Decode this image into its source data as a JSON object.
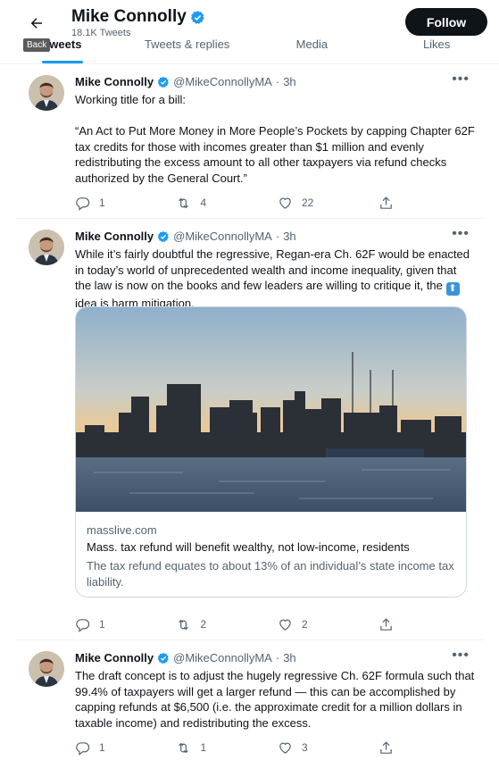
{
  "header": {
    "back_tooltip": "Back",
    "name": "Mike Connolly",
    "tweet_count": "18.1K Tweets",
    "follow_label": "Follow"
  },
  "tabs": [
    {
      "label": "Tweets",
      "active": true
    },
    {
      "label": "Tweets & replies",
      "active": false
    },
    {
      "label": "Media",
      "active": false
    },
    {
      "label": "Likes",
      "active": false
    }
  ],
  "tweets": [
    {
      "name": "Mike Connolly",
      "handle": "@MikeConnollyMA",
      "sep": "·",
      "time": "3h",
      "text": "Working title for a bill:\n\n“An Act to Put More Money in More People’s Pockets by capping Chapter 62F tax credits for those with incomes greater than $1 million and evenly redistributing the excess amount to all other taxpayers via refund checks authorized by the General Court.”",
      "replies": "1",
      "retweets": "4",
      "likes": "22"
    },
    {
      "name": "Mike Connolly",
      "handle": "@MikeConnollyMA",
      "sep": "·",
      "time": "3h",
      "text_before": "While it’s fairly doubtful the regressive, Regan-era Ch. 62F would be enacted in today’s world of unprecedented wealth and income inequality, given that the law is now on the books and few leaders are willing to critique it, the ",
      "emoji": "⬆",
      "text_after": " idea is harm mitigation.",
      "card": {
        "domain": "masslive.com",
        "title": "Mass. tax refund will benefit wealthy, not low-income, residents",
        "description": "The tax refund equates to about 13% of an individual’s state income tax liability."
      },
      "replies": "1",
      "retweets": "2",
      "likes": "2"
    },
    {
      "name": "Mike Connolly",
      "handle": "@MikeConnollyMA",
      "sep": "·",
      "time": "3h",
      "text": "The draft concept is to adjust the hugely regressive Ch. 62F formula such that 99.4% of taxpayers will get a larger refund — this can be accomplished by capping refunds at $6,500 (i.e. the approximate credit for a million dollars in taxable income) and redistributing the excess.",
      "replies": "1",
      "retweets": "1",
      "likes": "3"
    }
  ],
  "icons": {
    "back": "arrow-left-icon",
    "verified": "verified-badge-icon",
    "more": "more-icon",
    "reply": "reply-icon",
    "retweet": "retweet-icon",
    "like": "heart-icon",
    "share": "share-icon"
  },
  "colors": {
    "accent": "#1d9bf0",
    "text": "#0f1419",
    "muted": "#536471",
    "follow_bg": "#0f1419"
  }
}
